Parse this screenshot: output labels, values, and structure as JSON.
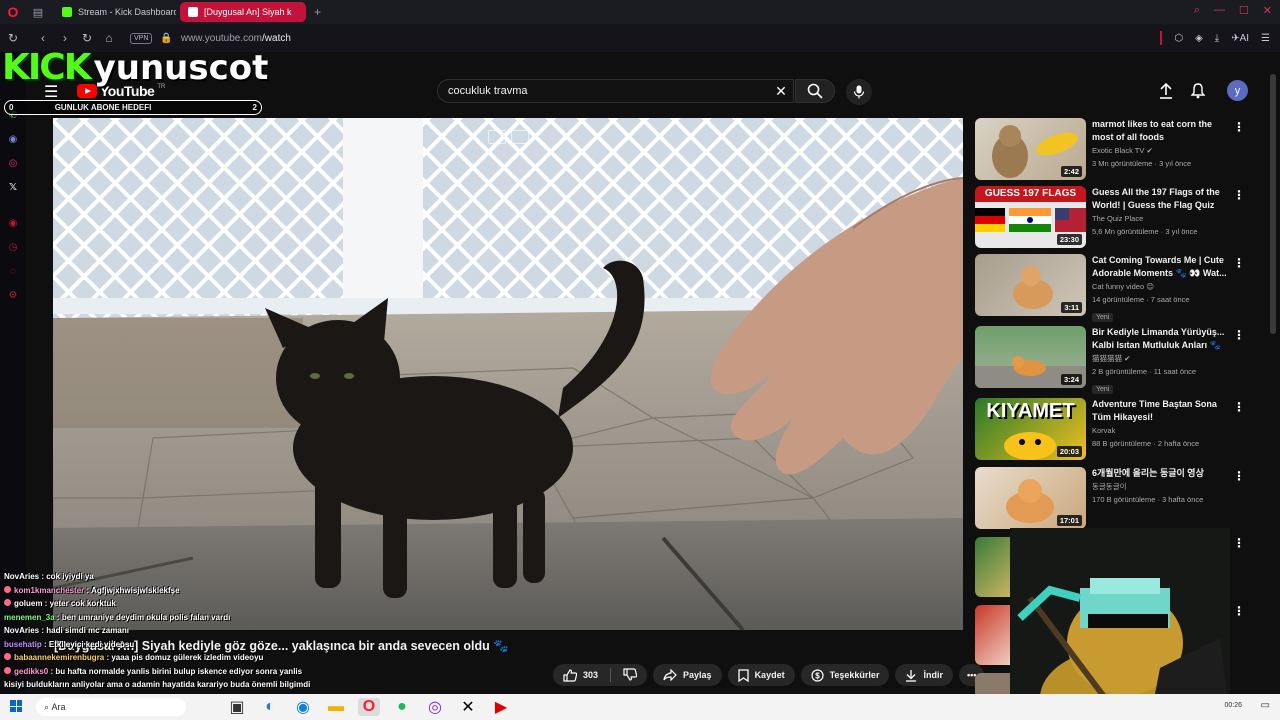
{
  "browser": {
    "tabs": [
      {
        "label": "Stream - Kick Dashboard",
        "favicon_color": "#53fc18"
      },
      {
        "label": "[Duygusal An] Siyah k",
        "favicon_color": "#ff0000"
      }
    ],
    "new_tab": "+",
    "vpn_label": "VPN",
    "url_host": "www.youtube.com",
    "url_path": "/watch",
    "ai_label": "AI"
  },
  "overlay": {
    "kick_logo": "KICK",
    "username": "yunuscot",
    "sub_goal_label": "GUNLUK ABONE HEDEFI",
    "sub_goal_current": "0",
    "sub_goal_target": "2",
    "sub_goal_progress": 0
  },
  "youtube": {
    "logo_text": "YouTube",
    "logo_tr": "TR",
    "search_value": "cocukluk travma",
    "avatar_letter": "y",
    "video_title": "[Duygusal An] Siyah kediyle göz göze... yaklaşınca bir anda sevecen oldu 🐾",
    "actions": {
      "likes": "303",
      "share": "Paylaş",
      "save": "Kaydet",
      "thanks": "Teşekkürler",
      "download": "İndir"
    }
  },
  "suggestions": [
    {
      "title": "marmot likes to eat corn the most of all foods",
      "channel": "Exotic Black TV",
      "verified": true,
      "stats": "3 Mn görüntüleme · 3 yıl önce",
      "duration": "2:42",
      "new": ""
    },
    {
      "title": "Guess All the 197 Flags of the World! | Guess the Flag Quiz",
      "channel": "The Quiz Place",
      "verified": false,
      "stats": "5,6 Mn görüntüleme · 3 yıl önce",
      "duration": "23:30",
      "new": "",
      "thumb_text": "GUESS 197 FLAGS"
    },
    {
      "title": "Cat Coming Towards Me | Cute Adorable Moments 🐾 👀 Wat...",
      "channel": "Cat funny video 😊",
      "verified": false,
      "stats": "14 görüntüleme · 7 saat önce",
      "duration": "3:11",
      "new": "Yeni"
    },
    {
      "title": "Bir Kediyle Limanda Yürüyüş... Kalbi Isıtan Mutluluk Anları 🐾",
      "channel": "猫猫猫猫",
      "verified": true,
      "stats": "2 B görüntüleme · 11 saat önce",
      "duration": "3:24",
      "new": "Yeni"
    },
    {
      "title": "Adventure Time Baştan Sona Tüm Hikayesi!",
      "channel": "Korvak",
      "verified": false,
      "stats": "88 B görüntüleme · 2 hafta önce",
      "duration": "20:03",
      "new": "",
      "thumb_text": "KIYAMET"
    },
    {
      "title": "6개월만에 올리는 동글이 영상",
      "channel": "동글동글이",
      "verified": false,
      "stats": "170 B görüntüleme · 3 hafta önce",
      "duration": "17:01",
      "new": ""
    }
  ],
  "chat": [
    {
      "user": "NovAries",
      "color": "#ffffff",
      "msg": "cok iyiydi ya",
      "badge": false
    },
    {
      "user": "kom1kmanchester",
      "color": "#ff9ad8",
      "msg": "Agfjwjxhwisjwlsklekfşe",
      "badge": true
    },
    {
      "user": "goluem",
      "color": "#ffffff",
      "msg": "yeter cok korktuk",
      "badge": true
    },
    {
      "user": "menemen_3a",
      "color": "#7cff7c",
      "msg": "ben umraniye deydim okula polis falan vardı",
      "badge": false
    },
    {
      "user": "NovAries",
      "color": "#ffffff",
      "msg": "hadi simdi mc zamanı",
      "badge": false
    },
    {
      "user": "busehatip",
      "color": "#c48bff",
      "msg": "Etkileyici kedi videosu",
      "badge": false
    },
    {
      "user": "babaannekemirenbugra",
      "color": "#ffd36b",
      "msg": "yaaa pis domuz gülerek izledim videoyu",
      "badge": true
    },
    {
      "user": "gedikks0",
      "color": "#ff9ad8",
      "msg": "bu hafta normalde yanlis birini bulup iskence ediyor sonra yanlis",
      "badge": true
    },
    {
      "user": "",
      "color": "#ffffff",
      "msg": "kisiyi buldukların anliyolar ama o adamin hayatida karariyo buda önemli bilgimdi",
      "badge": false
    }
  ],
  "taskbar": {
    "search_placeholder": "Ara",
    "time": "00:26"
  }
}
